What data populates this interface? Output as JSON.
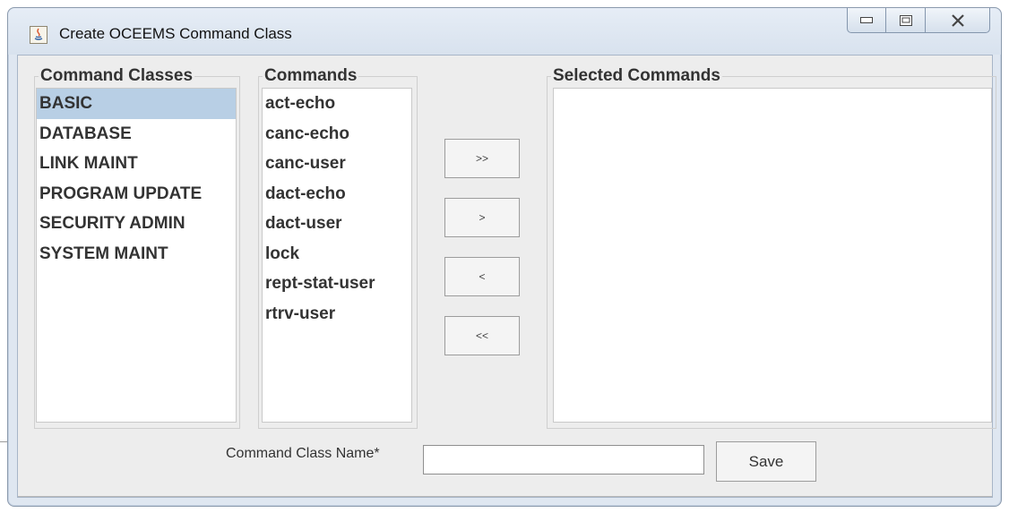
{
  "window": {
    "title": "Create OCEEMS Command Class",
    "controls": [
      "minimize-icon",
      "maximize-icon",
      "close-icon"
    ]
  },
  "command_classes": {
    "legend": "Command Classes",
    "items": [
      "BASIC",
      "DATABASE",
      "LINK MAINT",
      "PROGRAM UPDATE",
      "SECURITY ADMIN",
      "SYSTEM MAINT"
    ],
    "selected": "BASIC"
  },
  "commands": {
    "legend": "Commands",
    "items": [
      "act-echo",
      "canc-echo",
      "canc-user",
      "dact-echo",
      "dact-user",
      "lock",
      "rept-stat-user",
      "rtrv-user"
    ]
  },
  "transfer_buttons": {
    "add_all": ">>",
    "add": ">",
    "remove": "<",
    "remove_all": "<<"
  },
  "selected_commands": {
    "legend": "Selected Commands",
    "items": []
  },
  "form": {
    "name_label": "Command Class Name*",
    "name_value": "",
    "save_label": "Save"
  }
}
